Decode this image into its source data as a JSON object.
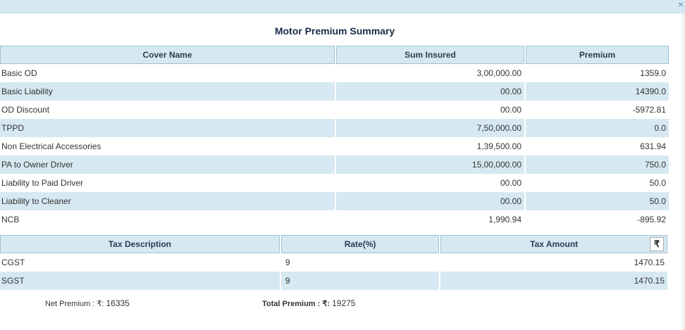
{
  "dialog": {
    "title": "Motor Premium Summary",
    "close_icon": "close-icon"
  },
  "cover_table": {
    "headers": [
      "Cover Name",
      "Sum Insured",
      "Premium"
    ],
    "rows": [
      {
        "name": "Basic OD",
        "sum_insured": "3,00,000.00",
        "premium": "1359.0"
      },
      {
        "name": "Basic Liability",
        "sum_insured": "00.00",
        "premium": "14390.0"
      },
      {
        "name": "OD Discount",
        "sum_insured": "00.00",
        "premium": "-5972.81"
      },
      {
        "name": "TPPD",
        "sum_insured": "7,50,000.00",
        "premium": "0.0"
      },
      {
        "name": "Non Electrical Accessories",
        "sum_insured": "1,39,500.00",
        "premium": "631.94"
      },
      {
        "name": "PA to Owner Driver",
        "sum_insured": "15,00,000.00",
        "premium": "750.0"
      },
      {
        "name": "Liability to Paid Driver",
        "sum_insured": "00.00",
        "premium": "50.0"
      },
      {
        "name": "Liability to Cleaner",
        "sum_insured": "00.00",
        "premium": "50.0"
      },
      {
        "name": "NCB",
        "sum_insured": "1,990.94",
        "premium": "-895.92"
      }
    ]
  },
  "tax_table": {
    "headers": [
      "Tax Description",
      "Rate(%)",
      "Tax Amount"
    ],
    "currency_symbol": "₹",
    "rows": [
      {
        "description": "CGST",
        "rate": "9",
        "amount": "1470.15"
      },
      {
        "description": "SGST",
        "rate": "9",
        "amount": "1470.15"
      }
    ]
  },
  "footer": {
    "net_label": "Net Premium : ₹: ",
    "net_value": "16335",
    "total_label": "Total Premium : ₹: ",
    "total_value": "19275"
  }
}
